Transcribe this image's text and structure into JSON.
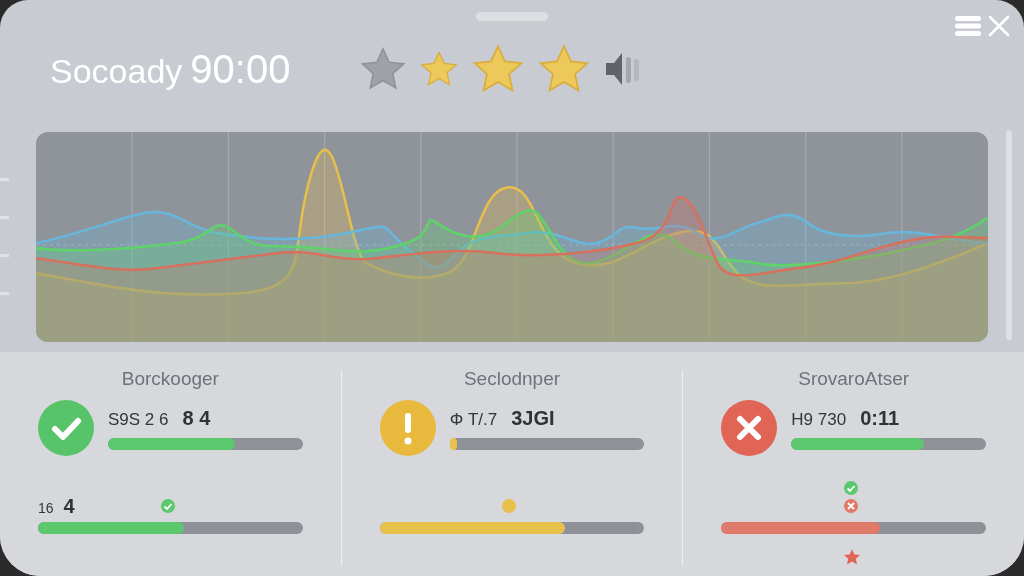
{
  "header": {
    "title": "Socoady",
    "time": "90:00",
    "stars": 3
  },
  "panels": [
    {
      "title": "Borckooger",
      "kind": "success",
      "reading": "S9S 2 6",
      "bars": [
        {
          "level": 0.65,
          "color": "#5cc86e",
          "overlay": "8 4"
        },
        {
          "label": "16",
          "level": 0.55,
          "color": "#5cc86e",
          "overlay": "4"
        }
      ]
    },
    {
      "title": "Seclodnper",
      "kind": "warning",
      "reading": "Φ T/.7",
      "bars": [
        {
          "level": 0.04,
          "color": "#e8c04c",
          "overlay": "3JGI"
        },
        {
          "level": 0.7,
          "color": "#e8c04c"
        }
      ]
    },
    {
      "title": "SrovaroAtser",
      "kind": "error",
      "reading": "H9  730",
      "bars": [
        {
          "level": 0.68,
          "color": "#5cc86e",
          "overlay": "0:11"
        },
        {
          "level": 0.6,
          "color": "#e07a68"
        }
      ]
    }
  ]
}
